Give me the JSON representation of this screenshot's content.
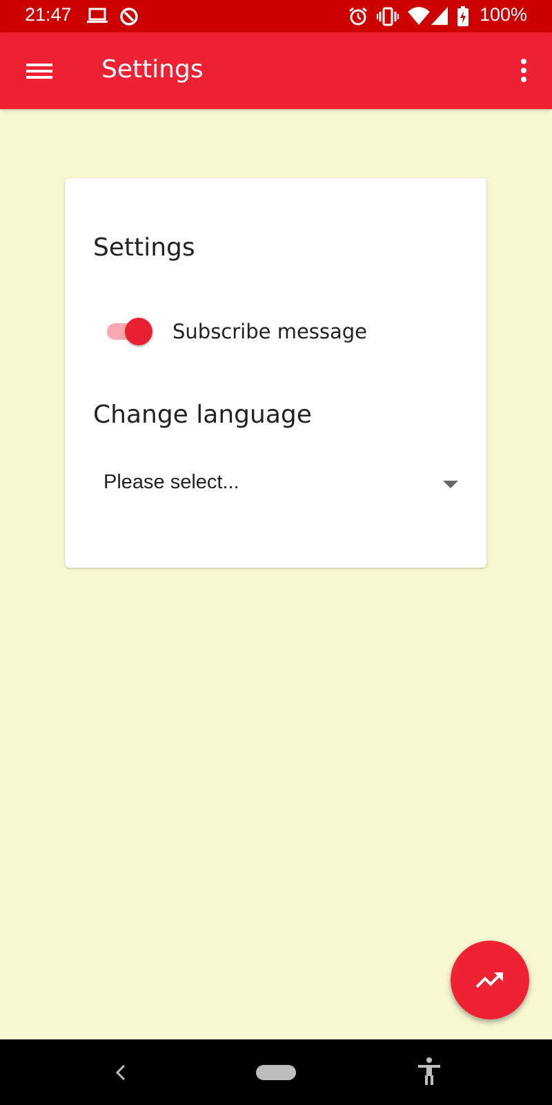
{
  "status_bar": {
    "time": "21:47",
    "battery": "100%",
    "icons": [
      "laptop-icon",
      "data-saver-icon",
      "alarm-icon",
      "vibrate-icon",
      "wifi-icon",
      "signal-icon",
      "battery-charging-icon"
    ]
  },
  "app_bar": {
    "title": "Settings",
    "icons": [
      "hamburger-menu-icon",
      "more-vert-icon"
    ]
  },
  "card": {
    "title": "Settings",
    "subscribe_switch": {
      "label": "Subscribe message",
      "on": true
    },
    "language": {
      "title": "Change language",
      "selected": "Please select..."
    }
  },
  "fab": {
    "icon": "trending-up-icon"
  },
  "nav_bar": {
    "icons": [
      "back-icon",
      "home-pill",
      "accessibility-icon"
    ]
  },
  "colors": {
    "status_bar": "#cc0000",
    "app_bar": "#ee2233",
    "background": "#f8f8d0",
    "accent": "#e8202f",
    "switch_track": "#f7a9b0"
  }
}
